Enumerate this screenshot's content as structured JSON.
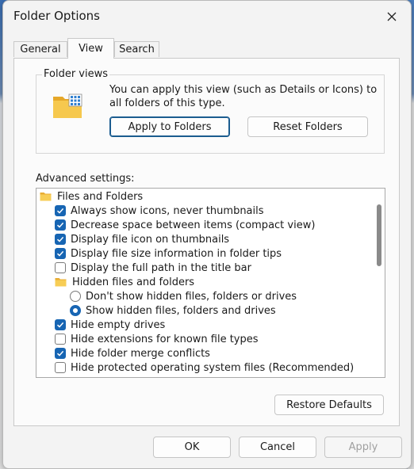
{
  "window": {
    "title": "Folder Options"
  },
  "tabs": [
    {
      "label": "General",
      "active": false
    },
    {
      "label": "View",
      "active": true
    },
    {
      "label": "Search",
      "active": false
    }
  ],
  "folder_views": {
    "group_label": "Folder views",
    "description": "You can apply this view (such as Details or Icons) to all folders of this type.",
    "apply_button": "Apply to Folders",
    "reset_button": "Reset Folders"
  },
  "advanced": {
    "label": "Advanced settings:",
    "items": [
      {
        "type": "folder",
        "label": "Files and Folders",
        "indent": 0
      },
      {
        "type": "checkbox",
        "label": "Always show icons, never thumbnails",
        "checked": true,
        "indent": 1
      },
      {
        "type": "checkbox",
        "label": "Decrease space between items (compact view)",
        "checked": true,
        "indent": 1
      },
      {
        "type": "checkbox",
        "label": "Display file icon on thumbnails",
        "checked": true,
        "indent": 1
      },
      {
        "type": "checkbox",
        "label": "Display file size information in folder tips",
        "checked": true,
        "indent": 1
      },
      {
        "type": "checkbox",
        "label": "Display the full path in the title bar",
        "checked": false,
        "indent": 1
      },
      {
        "type": "folder",
        "label": "Hidden files and folders",
        "indent": 1
      },
      {
        "type": "radio",
        "label": "Don't show hidden files, folders or drives",
        "checked": false,
        "indent": 2
      },
      {
        "type": "radio",
        "label": "Show hidden files, folders and drives",
        "checked": true,
        "indent": 2
      },
      {
        "type": "checkbox",
        "label": "Hide empty drives",
        "checked": true,
        "indent": 1
      },
      {
        "type": "checkbox",
        "label": "Hide extensions for known file types",
        "checked": false,
        "indent": 1
      },
      {
        "type": "checkbox",
        "label": "Hide folder merge conflicts",
        "checked": true,
        "indent": 1
      },
      {
        "type": "checkbox",
        "label": "Hide protected operating system files (Recommended)",
        "checked": false,
        "indent": 1
      }
    ]
  },
  "buttons": {
    "restore": "Restore Defaults",
    "ok": "OK",
    "cancel": "Cancel",
    "apply": "Apply"
  },
  "colors": {
    "accent": "#1765b3",
    "folder": "#f2c14e"
  }
}
